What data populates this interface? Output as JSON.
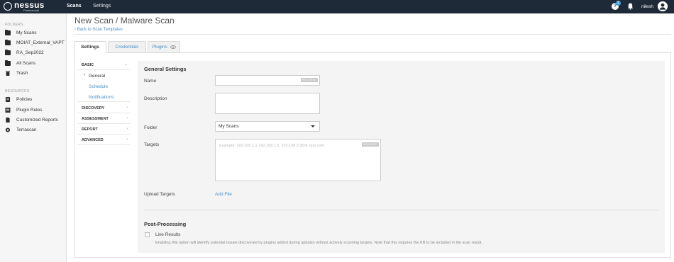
{
  "app": {
    "logo_name": "nessus",
    "logo_sub": "Professional"
  },
  "topnav": {
    "scans": "Scans",
    "settings": "Settings",
    "notification_count": "2",
    "username": "nilesh"
  },
  "sidebar": {
    "folders_title": "FOLDERS",
    "folders": [
      {
        "label": "My Scans",
        "icon": "folder-icon"
      },
      {
        "label": "MOIAT_External_VAPT",
        "icon": "folder-icon"
      },
      {
        "label": "RA_Sep2022",
        "icon": "folder-icon"
      },
      {
        "label": "All Scans",
        "icon": "folder-icon"
      },
      {
        "label": "Trash",
        "icon": "trash-icon"
      }
    ],
    "resources_title": "RESOURCES",
    "resources": [
      {
        "label": "Policies",
        "icon": "policies-icon"
      },
      {
        "label": "Plugin Rules",
        "icon": "plugin-rules-icon"
      },
      {
        "label": "Customized Reports",
        "icon": "report-icon"
      },
      {
        "label": "Terrascan",
        "icon": "terrascan-icon"
      }
    ]
  },
  "page": {
    "title": "New Scan / Malware Scan",
    "back_link": "Back to Scan Templates"
  },
  "tabs": [
    {
      "label": "Settings",
      "active": true
    },
    {
      "label": "Credentials",
      "active": false
    },
    {
      "label": "Plugins",
      "active": false
    }
  ],
  "settings_nav": {
    "basic": "BASIC",
    "general": "General",
    "schedule": "Schedule",
    "notifications": "Notifications",
    "discovery": "DISCOVERY",
    "assessment": "ASSESSMENT",
    "report": "REPORT",
    "advanced": "ADVANCED"
  },
  "form": {
    "general_heading": "General Settings",
    "name_label": "Name",
    "name_value": "",
    "required_badge": "REQUIRED",
    "description_label": "Description",
    "description_value": "",
    "folder_label": "Folder",
    "folder_value": "My Scans",
    "targets_label": "Targets",
    "targets_placeholder": "Example: 192.168.1.1-192.168.1.5, 192.168.2.0/24, test.com",
    "upload_label": "Upload Targets",
    "add_file": "Add File",
    "post_heading": "Post-Processing",
    "live_results_label": "Live Results",
    "live_results_checked": false,
    "live_results_help": "Enabling this option will identify potential issues discovered by plugins added during updates without actively scanning targets. Note that this requires the KB to be included in the scan result."
  },
  "colors": {
    "topbar": "#1f2a38",
    "link": "#4a8ec2",
    "badge": "#3fa4e0"
  }
}
